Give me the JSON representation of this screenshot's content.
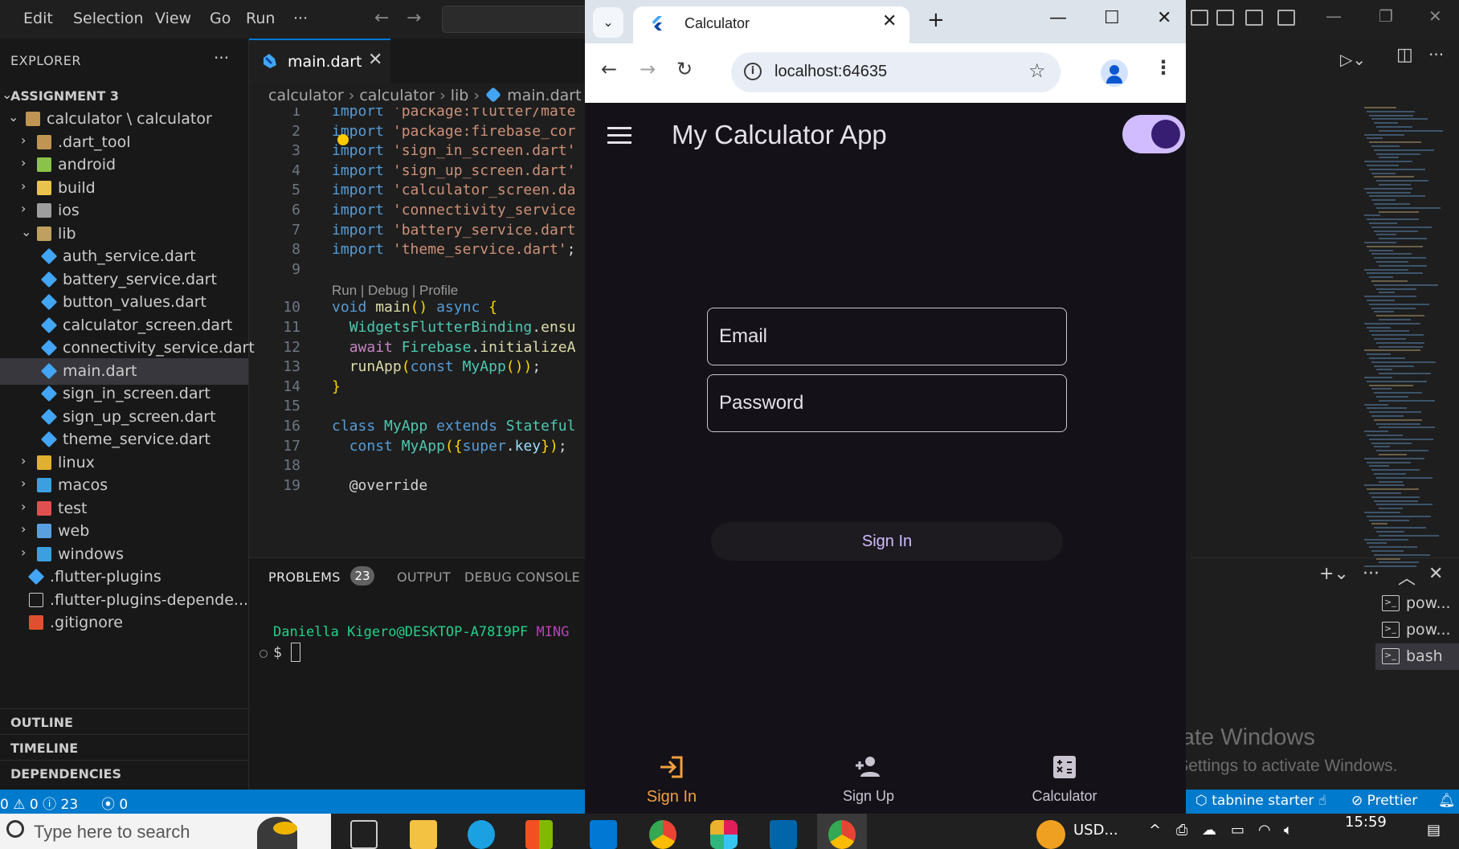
{
  "vscode": {
    "menu": [
      "Edit",
      "Selection",
      "View",
      "Go",
      "Run",
      "···"
    ],
    "explorer": {
      "title": "EXPLORER",
      "more": "···",
      "workspace": "ASSIGNMENT 3",
      "tree": [
        {
          "label": "calculator \\ calculator",
          "chev": "⌄",
          "icon": "folder-open"
        },
        {
          "label": ".dart_tool",
          "chev": "›",
          "icon": "folder"
        },
        {
          "label": "android",
          "chev": "›",
          "icon": "folder-android"
        },
        {
          "label": "build",
          "chev": "›",
          "icon": "folder-build"
        },
        {
          "label": "ios",
          "chev": "›",
          "icon": "folder-ios"
        },
        {
          "label": "lib",
          "chev": "⌄",
          "icon": "folder-lib"
        },
        {
          "label": "auth_service.dart",
          "icon": "dart-file"
        },
        {
          "label": "battery_service.dart",
          "icon": "dart-file"
        },
        {
          "label": "button_values.dart",
          "icon": "dart-file"
        },
        {
          "label": "calculator_screen.dart",
          "icon": "dart-file"
        },
        {
          "label": "connectivity_service.dart",
          "icon": "dart-file"
        },
        {
          "label": "main.dart",
          "icon": "dart-file",
          "selected": true
        },
        {
          "label": "sign_in_screen.dart",
          "icon": "dart-file"
        },
        {
          "label": "sign_up_screen.dart",
          "icon": "dart-file"
        },
        {
          "label": "theme_service.dart",
          "icon": "dart-file"
        },
        {
          "label": "linux",
          "chev": "›",
          "icon": "folder-linux"
        },
        {
          "label": "macos",
          "chev": "›",
          "icon": "folder-macos"
        },
        {
          "label": "test",
          "chev": "›",
          "icon": "folder-test"
        },
        {
          "label": "web",
          "chev": "›",
          "icon": "folder-web"
        },
        {
          "label": "windows",
          "chev": "›",
          "icon": "folder-windows"
        },
        {
          "label": ".flutter-plugins",
          "icon": "flutter-file"
        },
        {
          "label": ".flutter-plugins-depende...",
          "icon": "file"
        },
        {
          "label": ".gitignore",
          "icon": "git-file"
        }
      ],
      "sections": [
        "OUTLINE",
        "TIMELINE",
        "DEPENDENCIES"
      ]
    },
    "editor": {
      "tab": {
        "label": "main.dart",
        "close": "✕"
      },
      "breadcrumb": [
        "calculator",
        "calculator",
        "lib",
        "main.dart"
      ],
      "code_lens": "Run | Debug | Profile",
      "lines": [
        {
          "n": "1",
          "text": "import 'package:flutter/mate"
        },
        {
          "n": "2",
          "text": "import 'package:firebase_cor"
        },
        {
          "n": "3",
          "text": "import 'sign_in_screen.dart'"
        },
        {
          "n": "4",
          "text": "import 'sign_up_screen.dart'"
        },
        {
          "n": "5",
          "text": "import 'calculator_screen.da"
        },
        {
          "n": "6",
          "text": "import 'connectivity_service"
        },
        {
          "n": "7",
          "text": "import 'battery_service.dart"
        },
        {
          "n": "8",
          "text": "import 'theme_service.dart';"
        },
        {
          "n": "9",
          "text": ""
        },
        {
          "n": "10",
          "text": "void main() async {"
        },
        {
          "n": "11",
          "text": "  WidgetsFlutterBinding.ensu"
        },
        {
          "n": "12",
          "text": "  await Firebase.initializeA"
        },
        {
          "n": "13",
          "text": "  runApp(const MyApp());"
        },
        {
          "n": "14",
          "text": "}"
        },
        {
          "n": "15",
          "text": ""
        },
        {
          "n": "16",
          "text": "class MyApp extends Stateful"
        },
        {
          "n": "17",
          "text": "  const MyApp({super.key});"
        },
        {
          "n": "18",
          "text": ""
        },
        {
          "n": "19",
          "text": "  @override"
        }
      ]
    },
    "panel": {
      "tabs": [
        "PROBLEMS",
        "OUTPUT",
        "DEBUG CONSOLE"
      ],
      "problems_count": "23",
      "terminal_user": "Daniella Kigero@DESKTOP-A78I9PF",
      "terminal_host": "MING",
      "prompt": "$",
      "terminals": [
        "pow...",
        "pow...",
        "bash"
      ]
    },
    "statusbar": {
      "errors": "0",
      "warnings": "0",
      "infos": "23",
      "ports": "0",
      "tabnine": "tabnine starter",
      "prettier": "Prettier"
    }
  },
  "chrome": {
    "tab_title": "Calculator",
    "url": "localhost:64635"
  },
  "app": {
    "title": "My Calculator App",
    "email_placeholder": "Email",
    "password_placeholder": "Password",
    "signin_button": "Sign In",
    "nav": [
      {
        "label": "Sign In",
        "active": true
      },
      {
        "label": "Sign Up",
        "active": false
      },
      {
        "label": "Calculator",
        "active": false
      }
    ],
    "theme_dark_on": true
  },
  "windows": {
    "watermark_title": "Activate Windows",
    "watermark_sub": "Go to Settings to activate Windows.",
    "search_placeholder": "Type here to search",
    "tray_currency": "USD...",
    "clock": "15:59"
  },
  "colors": {
    "vscode_accent": "#007acc",
    "app_primary": "#d0bcff",
    "nav_active": "#f0a040"
  }
}
